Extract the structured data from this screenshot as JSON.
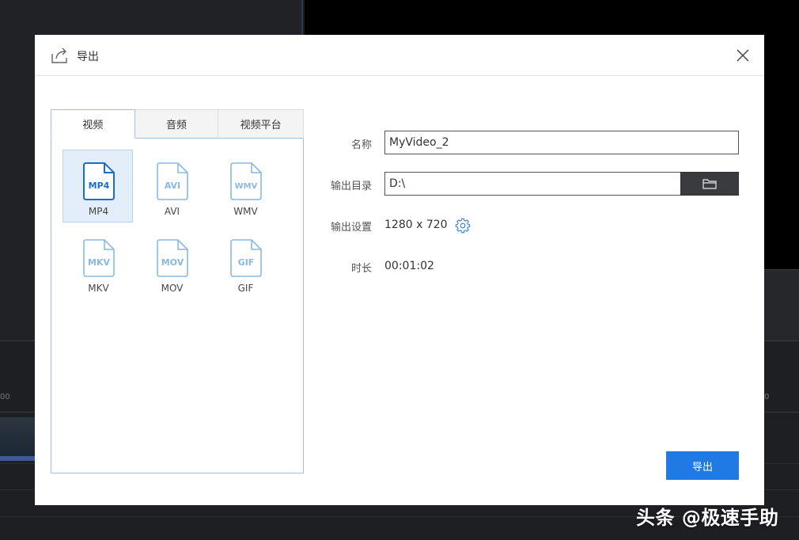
{
  "dialog": {
    "title": "导出",
    "icons": {
      "title": "export-share-icon",
      "close": "close-icon",
      "browse": "folder-icon",
      "settings": "gear-icon"
    }
  },
  "tabs": [
    {
      "label": "视频",
      "active": true
    },
    {
      "label": "音频",
      "active": false
    },
    {
      "label": "视频平台",
      "active": false
    }
  ],
  "formats": [
    {
      "label": "MP4",
      "badge": "MP4",
      "selected": true
    },
    {
      "label": "AVI",
      "badge": "AVI",
      "selected": false
    },
    {
      "label": "WMV",
      "badge": "WMV",
      "selected": false
    },
    {
      "label": "MKV",
      "badge": "MKV",
      "selected": false
    },
    {
      "label": "MOV",
      "badge": "MOV",
      "selected": false
    },
    {
      "label": "GIF",
      "badge": "GIF",
      "selected": false
    }
  ],
  "form": {
    "name_label": "名称",
    "name_value": "MyVideo_2",
    "dir_label": "输出目录",
    "dir_value": "D:\\",
    "settings_label": "输出设置",
    "settings_value": "1280 x 720",
    "duration_label": "时长",
    "duration_value": "00:01:02"
  },
  "export_button": "导出",
  "background": {
    "ruler_left": "00",
    "ruler_right": "0"
  },
  "watermark": "头条 @极速手助",
  "colors": {
    "accent": "#1f7ae3",
    "selected_bg": "#e4eefa",
    "format_icon_active": "#1a6fc4",
    "format_icon_inactive": "#8ab8e4",
    "browse_button": "#3a3b3e"
  }
}
